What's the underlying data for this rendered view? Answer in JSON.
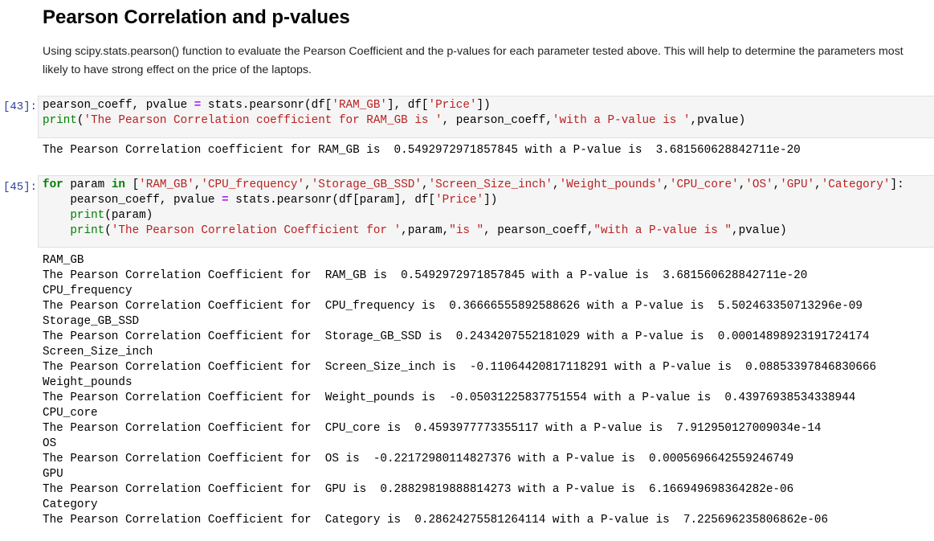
{
  "heading": "Pearson Correlation and p-values",
  "description": "Using scipy.stats.pearson() function to evaluate the Pearson Coefficient and the p-values for each parameter tested above. This will help to determine the parameters most likely to have strong effect on the price of the laptops.",
  "cells": [
    {
      "prompt": "[43]:",
      "code": [
        [
          {
            "t": "pearson_coeff, pvalue ",
            "c": "tx"
          },
          {
            "t": "=",
            "c": "op"
          },
          {
            "t": " stats.pearsonr(df[",
            "c": "tx"
          },
          {
            "t": "'RAM_GB'",
            "c": "st"
          },
          {
            "t": "], df[",
            "c": "tx"
          },
          {
            "t": "'Price'",
            "c": "st"
          },
          {
            "t": "])",
            "c": "tx"
          }
        ],
        [
          {
            "t": "print",
            "c": "bi"
          },
          {
            "t": "(",
            "c": "tx"
          },
          {
            "t": "'The Pearson Correlation coefficient for RAM_GB is '",
            "c": "st"
          },
          {
            "t": ", pearson_coeff,",
            "c": "tx"
          },
          {
            "t": "'with a P-value is '",
            "c": "st"
          },
          {
            "t": ",pvalue)",
            "c": "tx"
          }
        ]
      ],
      "output": [
        "The Pearson Correlation coefficient for RAM_GB is  0.5492972971857845 with a P-value is  3.681560628842711e-20"
      ]
    },
    {
      "prompt": "[45]:",
      "code": [
        [
          {
            "t": "for",
            "c": "kw"
          },
          {
            "t": " param ",
            "c": "tx"
          },
          {
            "t": "in",
            "c": "kw"
          },
          {
            "t": " [",
            "c": "tx"
          },
          {
            "t": "'RAM_GB'",
            "c": "st"
          },
          {
            "t": ",",
            "c": "tx"
          },
          {
            "t": "'CPU_frequency'",
            "c": "st"
          },
          {
            "t": ",",
            "c": "tx"
          },
          {
            "t": "'Storage_GB_SSD'",
            "c": "st"
          },
          {
            "t": ",",
            "c": "tx"
          },
          {
            "t": "'Screen_Size_inch'",
            "c": "st"
          },
          {
            "t": ",",
            "c": "tx"
          },
          {
            "t": "'Weight_pounds'",
            "c": "st"
          },
          {
            "t": ",",
            "c": "tx"
          },
          {
            "t": "'CPU_core'",
            "c": "st"
          },
          {
            "t": ",",
            "c": "tx"
          },
          {
            "t": "'OS'",
            "c": "st"
          },
          {
            "t": ",",
            "c": "tx"
          },
          {
            "t": "'GPU'",
            "c": "st"
          },
          {
            "t": ",",
            "c": "tx"
          },
          {
            "t": "'Category'",
            "c": "st"
          },
          {
            "t": "]:",
            "c": "tx"
          }
        ],
        [
          {
            "t": "    pearson_coeff, pvalue ",
            "c": "tx"
          },
          {
            "t": "=",
            "c": "op"
          },
          {
            "t": " stats.pearsonr(df[param], df[",
            "c": "tx"
          },
          {
            "t": "'Price'",
            "c": "st"
          },
          {
            "t": "])",
            "c": "tx"
          }
        ],
        [
          {
            "t": "    ",
            "c": "tx"
          },
          {
            "t": "print",
            "c": "bi"
          },
          {
            "t": "(param)",
            "c": "tx"
          }
        ],
        [
          {
            "t": "    ",
            "c": "tx"
          },
          {
            "t": "print",
            "c": "bi"
          },
          {
            "t": "(",
            "c": "tx"
          },
          {
            "t": "'The Pearson Correlation Coefficient for '",
            "c": "st"
          },
          {
            "t": ",param,",
            "c": "tx"
          },
          {
            "t": "\"is \"",
            "c": "st"
          },
          {
            "t": ", pearson_coeff,",
            "c": "tx"
          },
          {
            "t": "\"with a P-value is \"",
            "c": "st"
          },
          {
            "t": ",pvalue)",
            "c": "tx"
          }
        ]
      ],
      "output": [
        "RAM_GB",
        "The Pearson Correlation Coefficient for  RAM_GB is  0.5492972971857845 with a P-value is  3.681560628842711e-20",
        "CPU_frequency",
        "The Pearson Correlation Coefficient for  CPU_frequency is  0.36666555892588626 with a P-value is  5.502463350713296e-09",
        "Storage_GB_SSD",
        "The Pearson Correlation Coefficient for  Storage_GB_SSD is  0.2434207552181029 with a P-value is  0.00014898923191724174",
        "Screen_Size_inch",
        "The Pearson Correlation Coefficient for  Screen_Size_inch is  -0.11064420817118291 with a P-value is  0.08853397846830666",
        "Weight_pounds",
        "The Pearson Correlation Coefficient for  Weight_pounds is  -0.05031225837751554 with a P-value is  0.43976938534338944",
        "CPU_core",
        "The Pearson Correlation Coefficient for  CPU_core is  0.4593977773355117 with a P-value is  7.912950127009034e-14",
        "OS",
        "The Pearson Correlation Coefficient for  OS is  -0.22172980114827376 with a P-value is  0.0005696642559246749",
        "GPU",
        "The Pearson Correlation Coefficient for  GPU is  0.28829819888814273 with a P-value is  6.166949698364282e-06",
        "Category",
        "The Pearson Correlation Coefficient for  Category is  0.28624275581264114 with a P-value is  7.225696235806862e-06"
      ]
    }
  ]
}
